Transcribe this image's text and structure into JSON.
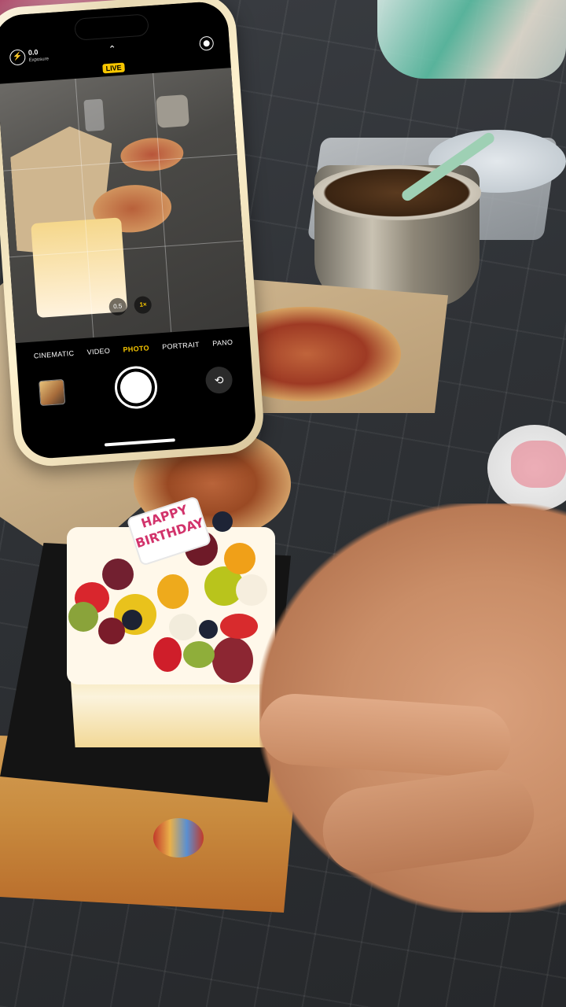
{
  "camera": {
    "exposure_value": "0.0",
    "exposure_subtitle": "Exposure",
    "live_badge": "LIVE",
    "zoom_options": [
      "0.5",
      "1×"
    ],
    "modes": [
      "CINEMATIC",
      "VIDEO",
      "PHOTO",
      "PORTRAIT",
      "PANO"
    ],
    "active_mode": "PHOTO",
    "accent_color": "#f7c600"
  },
  "cake_topper": {
    "line1": "HAPPY",
    "line2": "BIRTHDAY"
  }
}
